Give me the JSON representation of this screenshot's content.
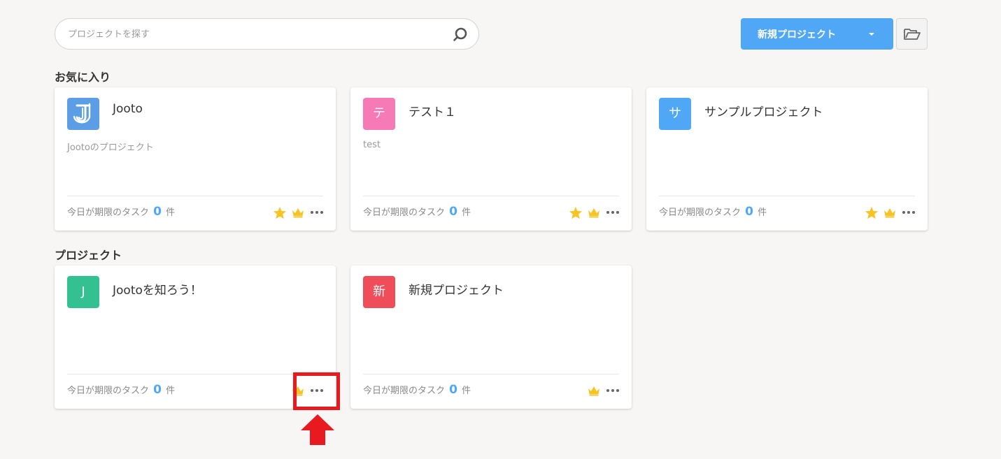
{
  "search": {
    "placeholder": "プロジェクトを探す"
  },
  "header": {
    "new_project_label": "新規プロジェクト"
  },
  "sections": {
    "favorites_title": "お気に入り",
    "projects_title": "プロジェクト"
  },
  "favorites": [
    {
      "title": "Jooto",
      "description": "Jootoのプロジェクト",
      "avatar_text": "",
      "avatar_color": "#5b9ee6",
      "footer_label": "今日が期限のタスク",
      "count": "0",
      "unit": "件"
    },
    {
      "title": "テスト１",
      "description": "test",
      "avatar_text": "テ",
      "avatar_color": "#f57ab6",
      "footer_label": "今日が期限のタスク",
      "count": "0",
      "unit": "件"
    },
    {
      "title": "サンプルプロジェクト",
      "description": "",
      "avatar_text": "サ",
      "avatar_color": "#4fa7f5",
      "footer_label": "今日が期限のタスク",
      "count": "0",
      "unit": "件"
    }
  ],
  "projects": [
    {
      "title": "Jootoを知ろう！",
      "description": "",
      "avatar_text": "J",
      "avatar_color": "#34c191",
      "footer_label": "今日が期限のタスク",
      "count": "0",
      "unit": "件"
    },
    {
      "title": "新規プロジェクト",
      "description": "",
      "avatar_text": "新",
      "avatar_color": "#ef4d5a",
      "footer_label": "今日が期限のタスク",
      "count": "0",
      "unit": "件"
    }
  ],
  "colors": {
    "accent": "#4fa7f5",
    "star": "#f7c325",
    "crown": "#f7c325",
    "highlight": "#e8191f"
  }
}
